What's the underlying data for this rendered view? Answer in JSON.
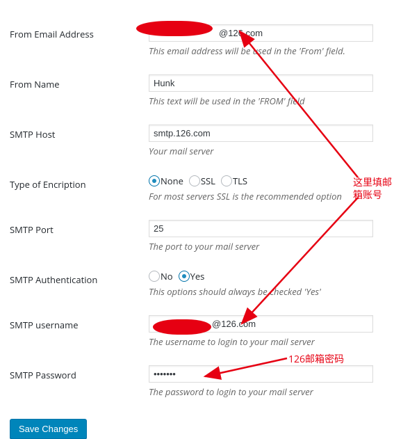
{
  "fields": {
    "from_email": {
      "label": "From Email Address",
      "value": "@126.com",
      "help": "This email address will be used in the 'From' field."
    },
    "from_name": {
      "label": "From Name",
      "value": "Hunk",
      "help": "This text will be used in the 'FROM' field"
    },
    "smtp_host": {
      "label": "SMTP Host",
      "value": "smtp.126.com",
      "help": "Your mail server"
    },
    "encryption": {
      "label": "Type of Encription",
      "options": {
        "none": "None",
        "ssl": "SSL",
        "tls": "TLS"
      },
      "help": "For most servers SSL is the recommended option"
    },
    "smtp_port": {
      "label": "SMTP Port",
      "value": "25",
      "help": "The port to your mail server"
    },
    "smtp_auth": {
      "label": "SMTP Authentication",
      "options": {
        "no": "No",
        "yes": "Yes"
      },
      "help": "This options should always be checked 'Yes'"
    },
    "smtp_user": {
      "label": "SMTP username",
      "value": "@126.com",
      "help": "The username to login to your mail server"
    },
    "smtp_pass": {
      "label": "SMTP Password",
      "value": "•••••••",
      "help": "The password to login to your mail server"
    }
  },
  "submit_label": "Save Changes",
  "annotations": {
    "account": "这里填邮\n箱账号",
    "password": "126邮箱密码"
  },
  "colors": {
    "accent": "#0085ba",
    "warn": "#e60012"
  }
}
